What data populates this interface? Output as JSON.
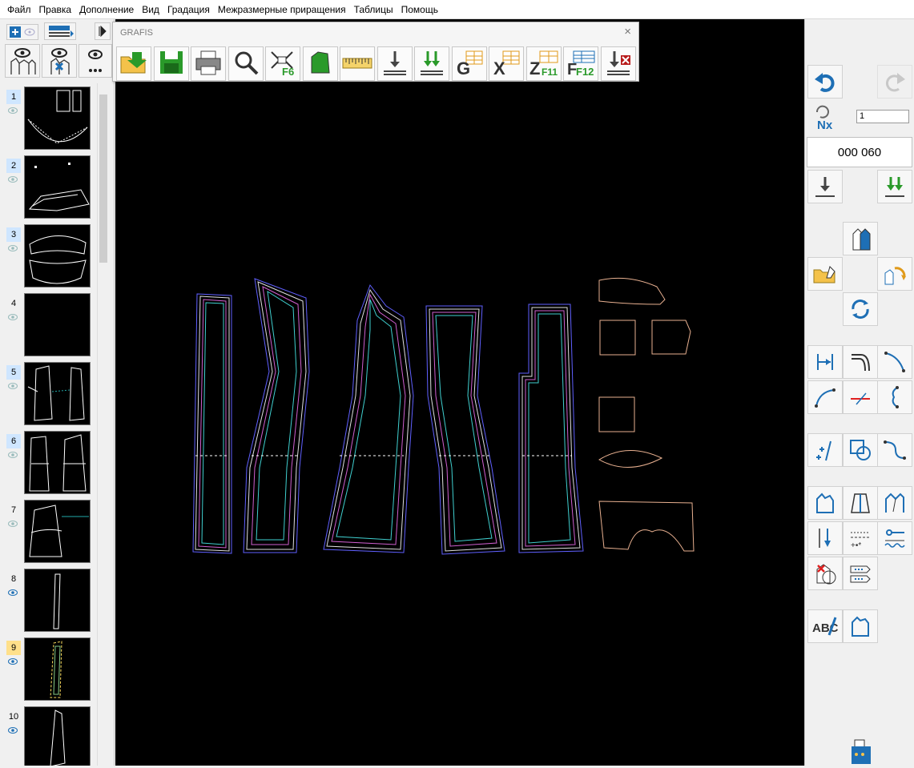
{
  "menu": [
    "Файл",
    "Правка",
    "Дополнение",
    "Вид",
    "Градация",
    "Межразмерные приращения",
    "Таблицы",
    "Помощь"
  ],
  "grafis": {
    "title": "GRAFIS",
    "close": "×",
    "buttons": [
      {
        "icon": "open-folder-icon"
      },
      {
        "icon": "save-disk-icon"
      },
      {
        "icon": "printer-icon"
      },
      {
        "icon": "zoom-magnifier-icon"
      },
      {
        "icon": "fit-f6-icon",
        "label": "F6"
      },
      {
        "icon": "piece-fill-icon"
      },
      {
        "icon": "ruler-icon"
      },
      {
        "icon": "down-arrow-icon"
      },
      {
        "icon": "double-down-arrow-icon"
      },
      {
        "icon": "table-g-icon",
        "label": "G"
      },
      {
        "icon": "table-x-icon",
        "label": "X"
      },
      {
        "icon": "table-z-f11-icon",
        "label": "Z",
        "sub": "F11"
      },
      {
        "icon": "table-f12-icon",
        "label": "F12"
      },
      {
        "icon": "delete-down-icon"
      }
    ]
  },
  "thumbnails": [
    {
      "num": "1",
      "highlight": "blue",
      "eye": "on-faded"
    },
    {
      "num": "2",
      "highlight": "blue",
      "eye": "on-faded"
    },
    {
      "num": "3",
      "highlight": "blue",
      "eye": "on-faded"
    },
    {
      "num": "4",
      "highlight": "none",
      "eye": "on-faded"
    },
    {
      "num": "5",
      "highlight": "blue",
      "eye": "on-faded"
    },
    {
      "num": "6",
      "highlight": "blue",
      "eye": "on-faded"
    },
    {
      "num": "7",
      "highlight": "none",
      "eye": "on-faded"
    },
    {
      "num": "8",
      "highlight": "none",
      "eye": "on"
    },
    {
      "num": "9",
      "highlight": "yellow",
      "eye": "on"
    },
    {
      "num": "10",
      "highlight": "none",
      "eye": "on"
    }
  ],
  "right": {
    "repeat_input": "1",
    "counter": "000 060",
    "nx_label": "Nx",
    "abc_label": "ABC"
  },
  "colors": {
    "canvas": "#000000",
    "accent_blue": "#1e6fb5",
    "green": "#2a9a2a"
  }
}
